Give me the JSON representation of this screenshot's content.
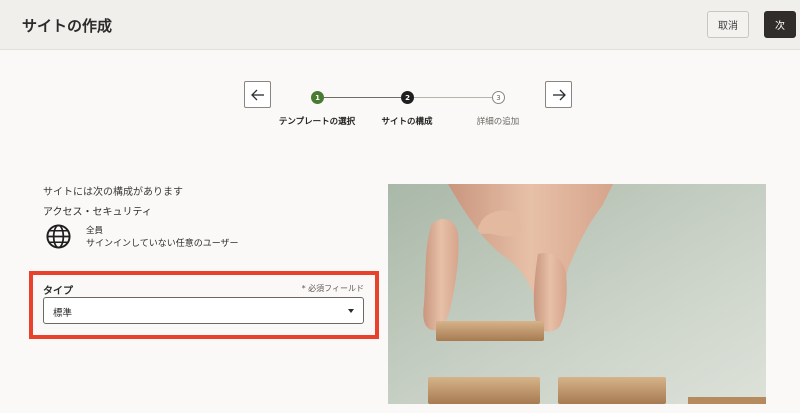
{
  "header": {
    "title": "サイトの作成",
    "cancel_label": "取消",
    "next_label": "次"
  },
  "train": {
    "steps": [
      {
        "number": "1",
        "label": "テンプレートの選択",
        "state": "done"
      },
      {
        "number": "2",
        "label": "サイトの構成",
        "state": "current"
      },
      {
        "number": "3",
        "label": "詳細の追加",
        "state": "todo"
      }
    ],
    "back_icon": "arrow-left-icon",
    "forward_icon": "arrow-right-icon"
  },
  "config": {
    "intro": "サイトには次の構成があります",
    "access_title": "アクセス・セキュリティ",
    "access_icon": "globe-icon",
    "access_who": "全員",
    "access_desc": "サインインしていない任意のユーザー"
  },
  "type_field": {
    "label": "タイプ",
    "required_hint": "* 必須フィールド",
    "value": "標準"
  },
  "colors": {
    "accent_done": "#497c32",
    "primary_button": "#312d2a",
    "highlight": "#e8412c"
  }
}
